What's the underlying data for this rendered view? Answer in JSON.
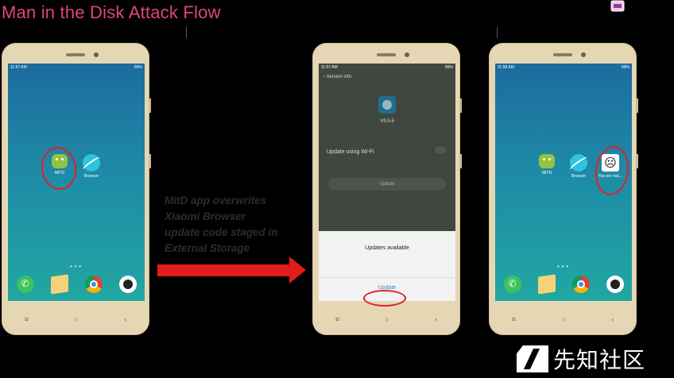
{
  "slide": {
    "title": "Man in the Disk Attack Flow"
  },
  "annotation": {
    "text_lines": [
      "MitD app overwrites",
      "Xiaomi Browser",
      "update code staged in",
      "External Storage"
    ]
  },
  "phone1": {
    "time": "11:57 AM",
    "battery": "89%",
    "apps": [
      {
        "label": "MITD",
        "icon": "android-icon"
      },
      {
        "label": "Browser",
        "icon": "browser-icon"
      }
    ]
  },
  "phone2": {
    "time": "11:57 AM",
    "battery": "89%",
    "header": "Version info",
    "version": "V9.5.6",
    "wifi_label": "Update using Wi-Fi",
    "update_button": "Update",
    "dialog_message": "Updates available",
    "dialog_button": "Update"
  },
  "phone3": {
    "time": "11:58 AM",
    "battery": "89%",
    "apps": [
      {
        "label": "MITD",
        "icon": "android-icon"
      },
      {
        "label": "Browser",
        "icon": "browser-icon"
      },
      {
        "label": "You are hac...",
        "icon": "guy-fawkes-mask-icon"
      }
    ]
  },
  "nav": {
    "menu": "≡",
    "home": "○",
    "back": "‹"
  },
  "brand": {
    "text": "先知社区"
  },
  "colors": {
    "title": "#e0457b",
    "arrow": "#e21b1b",
    "circle": "#e0202a"
  }
}
